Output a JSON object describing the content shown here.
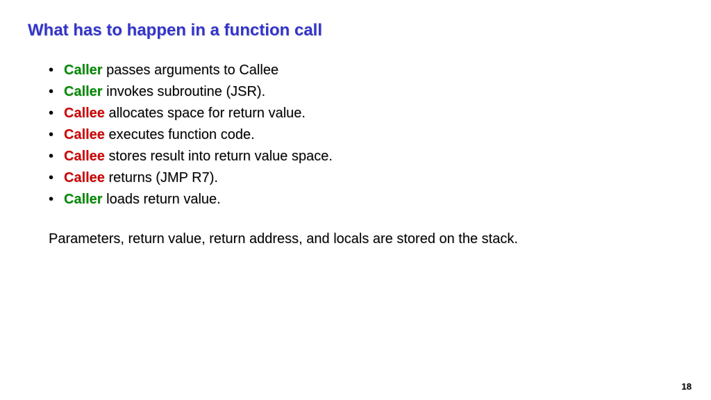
{
  "title": "What has to happen in a function call",
  "bullets": [
    {
      "role": "Caller",
      "roleClass": "role-caller",
      "text": " passes arguments to Callee"
    },
    {
      "role": "Caller",
      "roleClass": "role-caller",
      "text": " invokes subroutine (JSR)."
    },
    {
      "role": "Callee",
      "roleClass": "role-callee",
      "text": " allocates space for return value."
    },
    {
      "role": "Callee",
      "roleClass": "role-callee",
      "text": " executes function code."
    },
    {
      "role": "Callee",
      "roleClass": "role-callee",
      "text": " stores result into return value space."
    },
    {
      "role": "Callee",
      "roleClass": "role-callee",
      "text": " returns (JMP R7)."
    },
    {
      "role": "Caller",
      "roleClass": "role-caller",
      "text": " loads return value."
    }
  ],
  "summary": "Parameters, return value, return address, and locals are stored on the stack.",
  "pageNumber": "18"
}
